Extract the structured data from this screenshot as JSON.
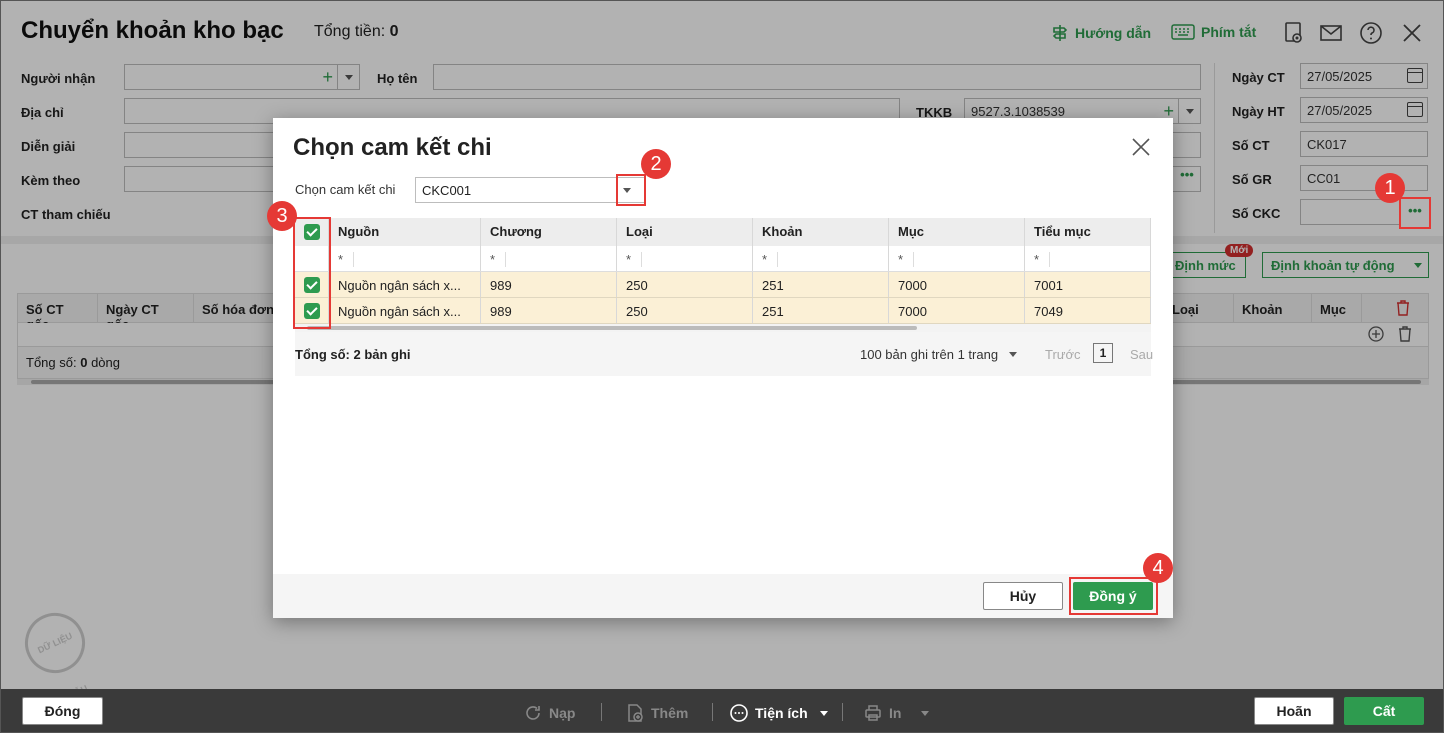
{
  "header": {
    "title": "Chuyển khoản kho bạc",
    "total_label": "Tổng tiền:",
    "total_value": "0",
    "guide": "Hướng dẫn",
    "shortcuts": "Phím tắt"
  },
  "form": {
    "nguoi_nhan_label": "Người nhận",
    "ho_ten_label": "Họ tên",
    "dia_chi_label": "Địa chỉ",
    "tkkb_label": "TKKB",
    "tkkb_value": "9527.3.1038539",
    "dien_giai_label": "Diễn giải",
    "kem_theo_label": "Kèm theo",
    "ct_tham_chieu_label": "CT tham chiếu",
    "ngay_ct_label": "Ngày CT",
    "ngay_ct_value": "27/05/2025",
    "ngay_ht_label": "Ngày HT",
    "ngay_ht_value": "27/05/2025",
    "so_ct_label": "Số CT",
    "so_ct_value": "CK017",
    "so_gr_label": "Số GR",
    "so_gr_value": "CC01",
    "so_ckc_label": "Số CKC"
  },
  "main_grid": {
    "columns": [
      "Số CT gốc",
      "Ngày CT gốc",
      "Số hóa đơn"
    ],
    "right_columns": [
      "Loại",
      "Khoản",
      "Mục"
    ],
    "total_label": "Tổng số:",
    "total_count": "0",
    "total_unit": "dòng",
    "dinh_muc_btn": "Định mức",
    "moi_badge": "Mới",
    "dinh_khoan_btn": "Định khoản tự động"
  },
  "dialog": {
    "title": "Chọn cam kết chi",
    "select_label": "Chọn cam kết chi",
    "select_value": "CKC001",
    "columns": [
      "Nguồn",
      "Chương",
      "Loại",
      "Khoản",
      "Mục",
      "Tiểu mục"
    ],
    "filter_symbol": "*",
    "rows": [
      [
        "Nguồn ngân sách x...",
        "989",
        "250",
        "251",
        "7000",
        "7001"
      ],
      [
        "Nguồn ngân sách x...",
        "989",
        "250",
        "251",
        "7000",
        "7049"
      ]
    ],
    "total_records": "Tổng số: 2 bản ghi",
    "page_size": "100 bản ghi trên 1 trang",
    "prev": "Trước",
    "page": "1",
    "next": "Sau",
    "cancel": "Hủy",
    "ok": "Đồng ý"
  },
  "bottom": {
    "close": "Đóng",
    "reload": "Nạp",
    "add": "Thêm",
    "utilities": "Tiện ích",
    "print": "In",
    "undo": "Hoãn",
    "save": "Cất"
  },
  "annotations": [
    "1",
    "2",
    "3",
    "4"
  ],
  "watermark": "DỮ LIỆU MẪU",
  "colors": {
    "accent": "#2e9b4f",
    "highlight": "#e53935",
    "row_selected": "#fbf0d6"
  }
}
